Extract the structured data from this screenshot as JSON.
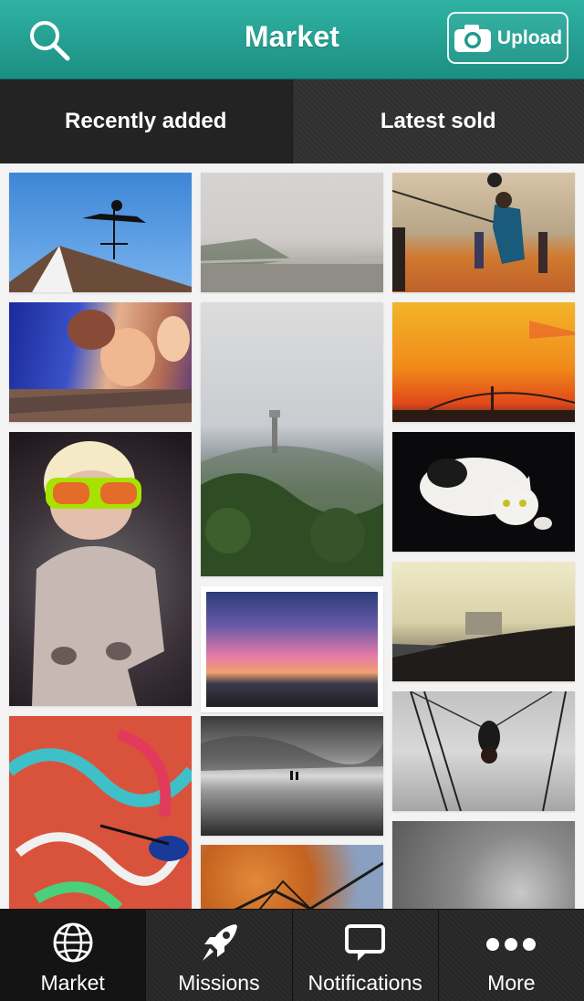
{
  "header": {
    "title": "Market",
    "upload_label": "Upload",
    "accent_color": "#23a293"
  },
  "tabs": [
    {
      "label": "Recently added",
      "active": true
    },
    {
      "label": "Latest sold",
      "active": false
    }
  ],
  "photos": [
    {
      "name": "weathervane-photo"
    },
    {
      "name": "foggy-road-photo"
    },
    {
      "name": "volleyball-beach-photo"
    },
    {
      "name": "mother-child-photo"
    },
    {
      "name": "hill-tower-photo"
    },
    {
      "name": "sunset-bridge-photo"
    },
    {
      "name": "child-sunglasses-photo"
    },
    {
      "name": "cat-photo"
    },
    {
      "name": "pink-sunset-photo"
    },
    {
      "name": "car-dashboard-photo"
    },
    {
      "name": "graffiti-wall-photo"
    },
    {
      "name": "beach-silhouette-photo"
    },
    {
      "name": "trampoline-photo"
    },
    {
      "name": "autumn-tree-photo"
    },
    {
      "name": "gray-texture-photo"
    }
  ],
  "tabbar": [
    {
      "label": "Market",
      "icon": "globe-icon",
      "active": true
    },
    {
      "label": "Missions",
      "icon": "rocket-icon",
      "active": false
    },
    {
      "label": "Notifications",
      "icon": "speech-bubble-icon",
      "active": false
    },
    {
      "label": "More",
      "icon": "more-dots-icon",
      "active": false
    }
  ]
}
